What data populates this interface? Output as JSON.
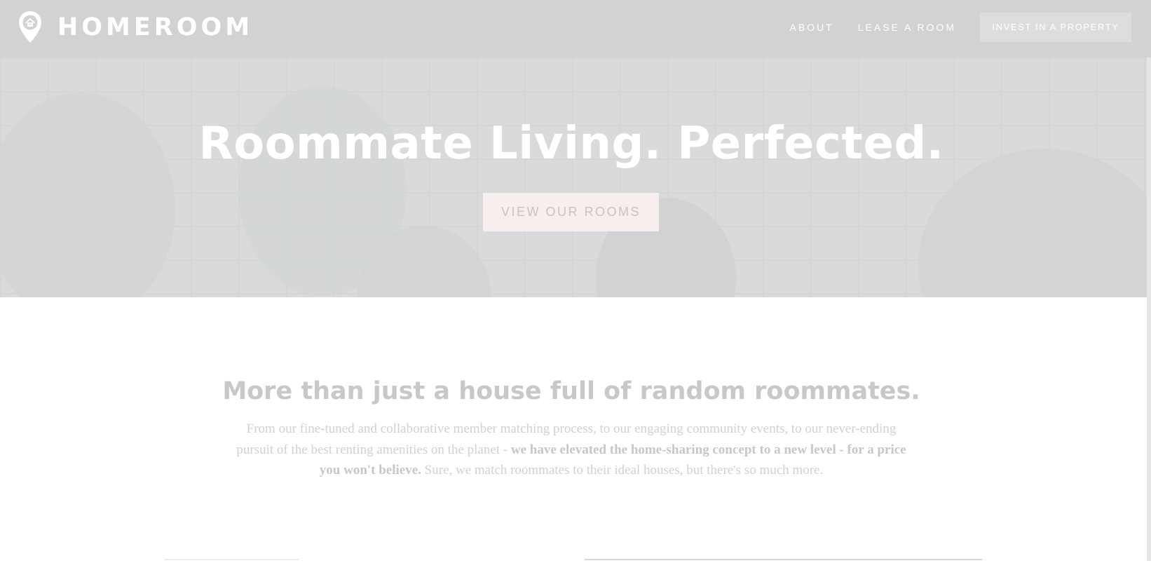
{
  "header": {
    "brand": "HOMEROOM",
    "logo_icon": "map-pin-house-icon",
    "nav": [
      {
        "label": "ABOUT"
      },
      {
        "label": "LEASE A ROOM"
      }
    ],
    "cta_label": "INVEST IN A PROPERTY"
  },
  "hero": {
    "title": "Roommate Living. Perfected.",
    "button_label": "VIEW OUR ROOMS"
  },
  "intro": {
    "heading": "More than just a house full of random roommates.",
    "body_start": "From our fine-tuned and collaborative member matching process, to our engaging community events, to our never-ending pursuit of the best renting amenities on the planet - ",
    "body_bold": "we have elevated the home-sharing concept to a new level - for a price you won't believe.",
    "body_end": " Sure, we match roommates to their ideal houses, but there's so much more."
  },
  "colors": {
    "header_bg": "#d1d3d3",
    "hero_button_bg": "#f6efee",
    "text_light": "#cfd1d2"
  }
}
